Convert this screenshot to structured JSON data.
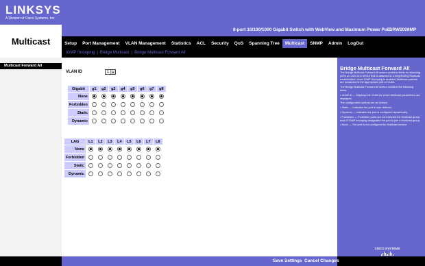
{
  "brand": {
    "logo": "LINKSYS",
    "tagline": "A Division of Cisco Systems, Inc."
  },
  "section_title": "Multicast",
  "product": {
    "title": "8-port 10/100/1000 Gigabit Switch with WebView and Maximum Power PoE",
    "model": "SRW2008MP"
  },
  "nav": [
    {
      "label": "Setup",
      "active": false
    },
    {
      "label": "Port Management",
      "active": false
    },
    {
      "label": "VLAN Management",
      "active": false
    },
    {
      "label": "Statistics",
      "active": false
    },
    {
      "label": "ACL",
      "active": false
    },
    {
      "label": "Security",
      "active": false
    },
    {
      "label": "QoS",
      "active": false
    },
    {
      "label": "Spanning Tree",
      "active": false
    },
    {
      "label": "Multicast",
      "active": true
    },
    {
      "label": "SNMP",
      "active": false
    },
    {
      "label": "Admin",
      "active": false
    },
    {
      "label": "LogOut",
      "active": false
    }
  ],
  "subnav": [
    "IGMP Snooping",
    "Bridge Multicast",
    "Bridge Multicast Forward All"
  ],
  "leftnav": {
    "item": "Multicast Forward All"
  },
  "vlan": {
    "label": "VLAN ID",
    "value": "1"
  },
  "gigabit_table": {
    "corner": "Gigabit",
    "columns": [
      "g1",
      "g2",
      "g3",
      "g4",
      "g5",
      "g6",
      "g7",
      "g8"
    ],
    "rows": [
      {
        "label": "None",
        "selected": true
      },
      {
        "label": "Forbidden",
        "selected": false
      },
      {
        "label": "Static",
        "selected": false
      },
      {
        "label": "Dynamic",
        "selected": false
      }
    ]
  },
  "lag_table": {
    "corner": "LAG",
    "columns": [
      "L1",
      "L2",
      "L3",
      "L4",
      "L5",
      "L6",
      "L7",
      "L8"
    ],
    "rows": [
      {
        "label": "None",
        "selected": true
      },
      {
        "label": "Forbidden",
        "selected": false
      },
      {
        "label": "Static",
        "selected": false
      },
      {
        "label": "Dynamic",
        "selected": false
      }
    ]
  },
  "help": {
    "title": "Bridge Multicast Forward All",
    "paragraphs": [
      "The Bridge Multicast Forward All screen contains fields for attaching ports or LAGs to a device that is attached to a neighboring Multicast router/switch. Once IGMP Snooping is enabled, Multicast packets are forwarded to the appropriate port or VLAN.",
      "The Bridge Multicast Forward All screen contains the following fields:",
      "• VLAN ID — Displays the VLAN for which Multicast parameters are displayed.",
      "The configuration options are as follows:",
      "• Static — Indicates the port is user-defined.",
      "• Dynamic — Indicates the port is configured dynamically.",
      "• Forbidden — Forbidden ports are not included the Multicast group, even if IGMP snooping designated the port to join a Multicast group.",
      "• None — The port is not configured for Multicast service."
    ]
  },
  "footer": {
    "save": "Save Settings",
    "cancel": "Cancel Changes",
    "cisco": "CISCO SYSTEMS"
  }
}
